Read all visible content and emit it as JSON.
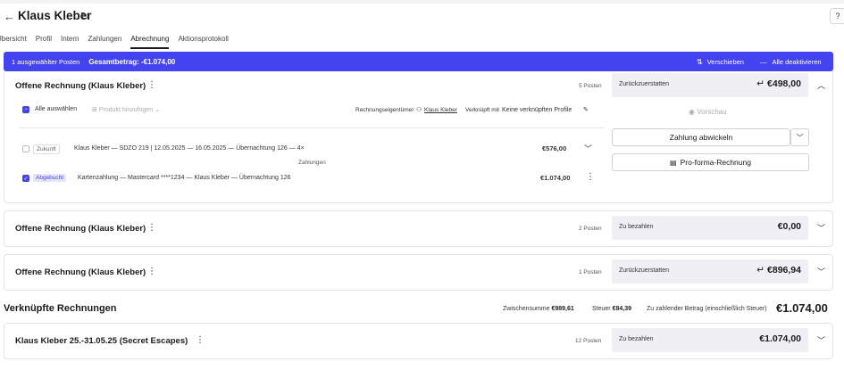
{
  "header": {
    "title": "Klaus Kleber"
  },
  "tabs": [
    {
      "label": "Übersicht"
    },
    {
      "label": "Profil"
    },
    {
      "label": "Intern"
    },
    {
      "label": "Zahlungen"
    },
    {
      "label": "Abrechnung"
    },
    {
      "label": "Aktionsprotokoll"
    }
  ],
  "selection_bar": {
    "selected": "1 ausgewählter Posten",
    "total": "Gesamtbetrag: -€1.074,00",
    "move_label": "Verschieben",
    "deactivate_label": "Alle deaktivieren"
  },
  "invoices": [
    {
      "title": "Offene Rechnung (Klaus Kleber)",
      "count": "5 Posten",
      "panel_label": "Zurückzuerstatten",
      "panel_amount": "€498,00",
      "expanded": true,
      "select_all": "Alle auswählen",
      "add_product": "Produkt hinzufügen",
      "owner_label": "Rechnungseigentümer",
      "owner_name": "Klaus Kleber",
      "linked_label": "Verknüpft mit",
      "linked_value": "Keine verknüpften Profile",
      "preview": "Vorschau",
      "process_payment": "Zahlung abwickeln",
      "proforma": "Pro-forma-Rechnung",
      "payments_divider": "Zahlungen",
      "rows": [
        {
          "badge": "Zukunft",
          "text": "Klaus Kleber — SDZO 219 | 12.05.2025 — 16.05.2025 — Übernachtung 126 — 4×",
          "amount": "€576,00",
          "checked": false
        },
        {
          "badge": "Abgebucht",
          "text": "Kartenzahlung — Mastercard ****1234 — Klaus Kleber — Übernachtung 126",
          "amount": "€1.074,00",
          "checked": true
        }
      ]
    },
    {
      "title": "Offene Rechnung (Klaus Kleber)",
      "count": "2 Posten",
      "panel_label": "Zu bezahlen",
      "panel_amount": "€0,00"
    },
    {
      "title": "Offene Rechnung (Klaus Kleber)",
      "count": "1 Posten",
      "panel_label": "Zurückzuerstatten",
      "panel_amount": "€896,94"
    }
  ],
  "linked": {
    "heading": "Verknüpfte Rechnungen",
    "subtotal_label": "Zwischensumme",
    "subtotal": "€989,61",
    "tax_label": "Steuer",
    "tax": "€84,39",
    "due_label": "Zu zahlender Betrag (einschließlich Steuer)",
    "due": "€1.074,00",
    "invoice": {
      "title": "Klaus Kleber 25.-31.05.25 (Secret Escapes)",
      "count": "12 Posten",
      "panel_label": "Zu bezahlen",
      "panel_amount": "€1.074,00"
    }
  }
}
